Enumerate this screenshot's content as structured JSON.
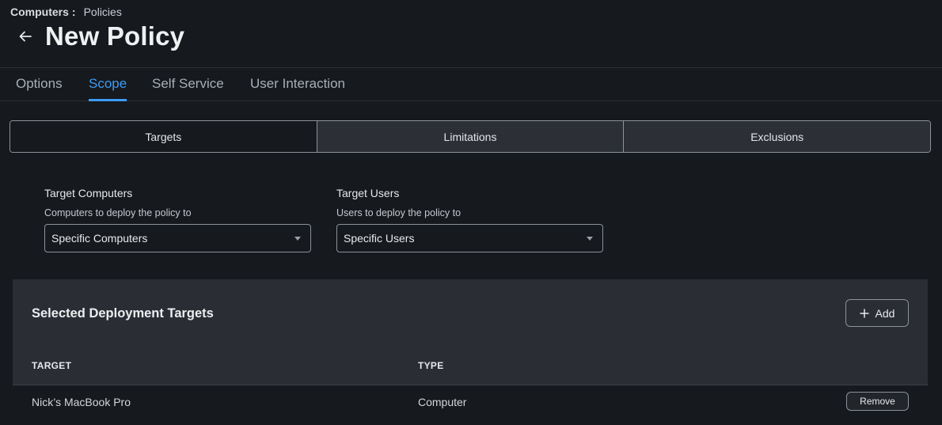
{
  "breadcrumb": {
    "parent": "Computers",
    "separator": ":",
    "current": "Policies"
  },
  "page": {
    "title": "New Policy"
  },
  "tabs": [
    {
      "label": "Options",
      "active": false
    },
    {
      "label": "Scope",
      "active": true
    },
    {
      "label": "Self Service",
      "active": false
    },
    {
      "label": "User Interaction",
      "active": false
    }
  ],
  "segments": [
    {
      "label": "Targets",
      "selected": true
    },
    {
      "label": "Limitations",
      "selected": false
    },
    {
      "label": "Exclusions",
      "selected": false
    }
  ],
  "target_computers": {
    "label": "Target Computers",
    "help": "Computers to deploy the policy to",
    "value": "Specific Computers"
  },
  "target_users": {
    "label": "Target Users",
    "help": "Users to deploy the policy to",
    "value": "Specific Users"
  },
  "deployment": {
    "title": "Selected Deployment Targets",
    "add_label": "Add",
    "columns": [
      "TARGET",
      "TYPE"
    ],
    "rows": [
      {
        "target": "Nick’s MacBook Pro",
        "type": "Computer",
        "action": "Remove"
      }
    ]
  },
  "colors": {
    "accent": "#3d9bf5",
    "background": "#16191d",
    "panel": "#2a2e34"
  },
  "icons": {
    "back": "arrow-left-icon",
    "dropdown": "caret-down-icon",
    "add": "plus-icon"
  }
}
